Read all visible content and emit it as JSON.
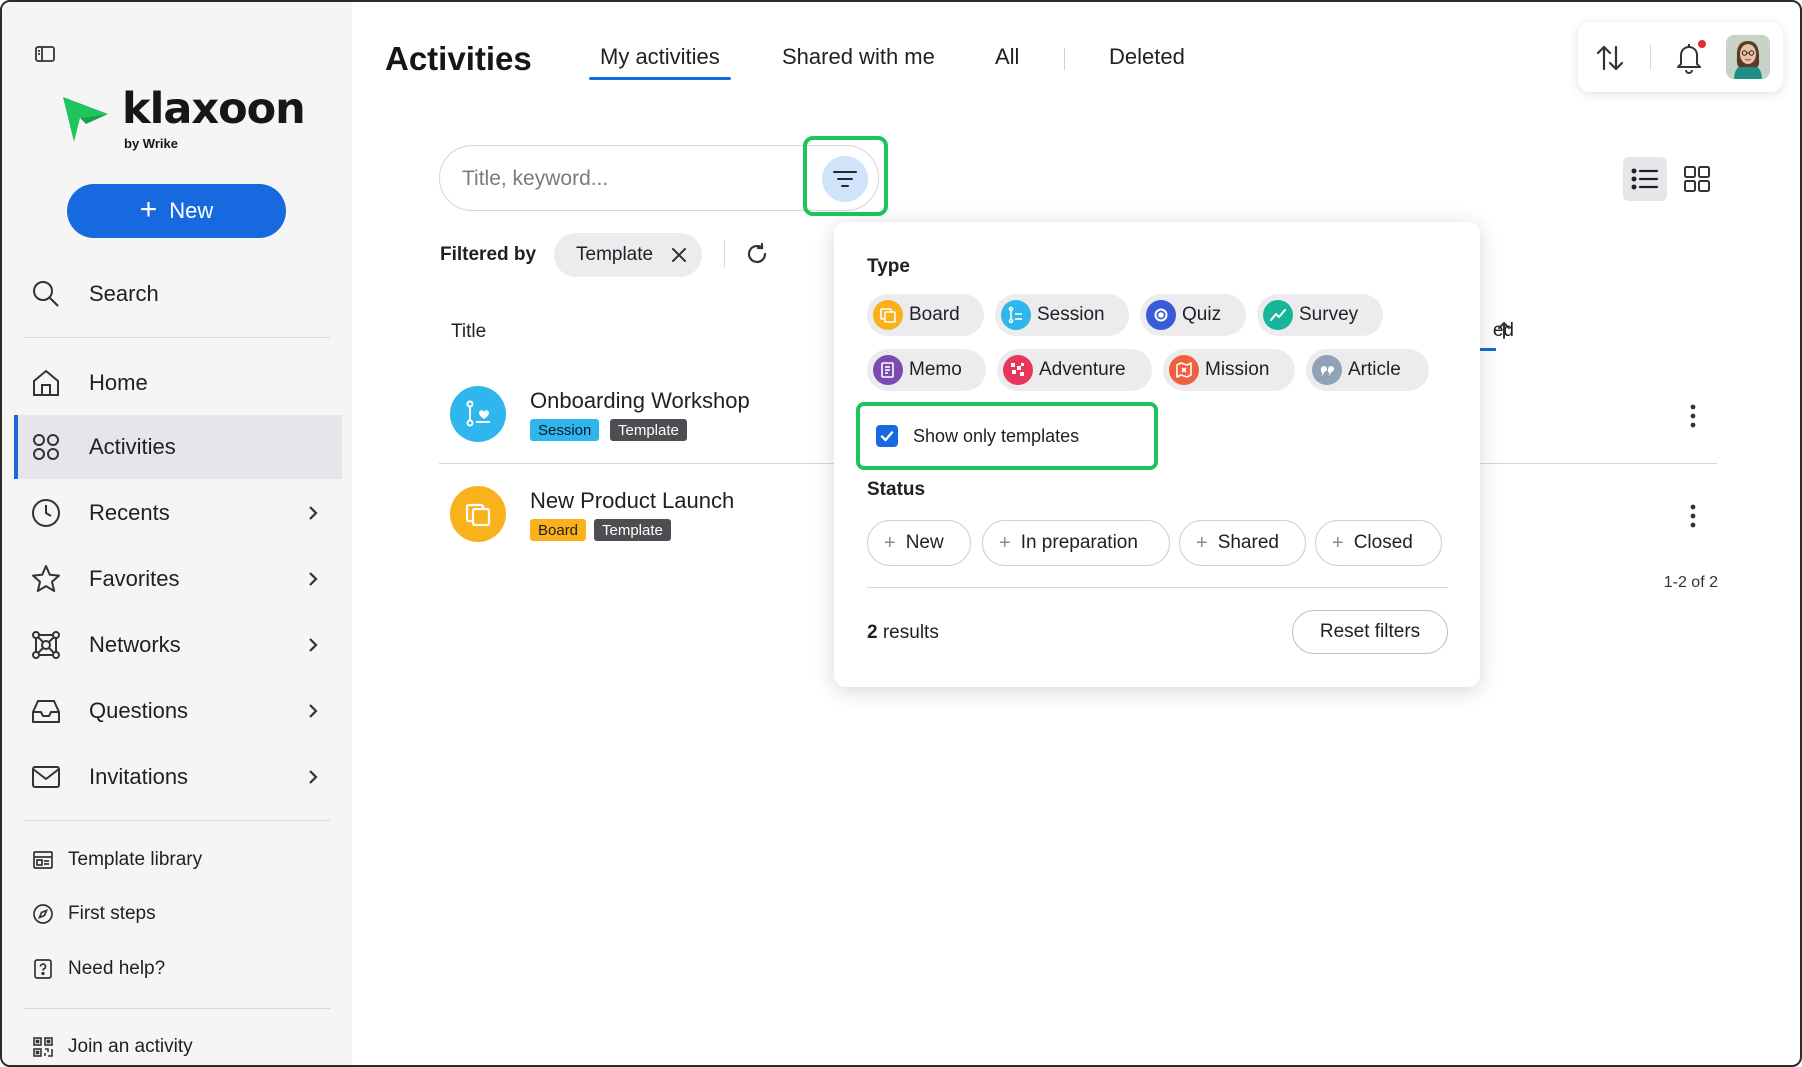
{
  "brand": {
    "name": "klaxoon",
    "sub": "by Wrike",
    "color": "#1fc45b"
  },
  "sidebar": {
    "new_label": "New",
    "search_label": "Search",
    "items": [
      {
        "label": "Home",
        "icon": "home-icon"
      },
      {
        "label": "Activities",
        "icon": "activities-icon",
        "active": true
      },
      {
        "label": "Recents",
        "icon": "clock-icon"
      },
      {
        "label": "Favorites",
        "icon": "star-icon"
      },
      {
        "label": "Networks",
        "icon": "network-icon"
      },
      {
        "label": "Questions",
        "icon": "inbox-icon"
      },
      {
        "label": "Invitations",
        "icon": "envelope-icon"
      }
    ],
    "bottom": [
      {
        "label": "Template library",
        "icon": "template-library-icon"
      },
      {
        "label": "First steps",
        "icon": "compass-icon"
      },
      {
        "label": "Need help?",
        "icon": "help-icon"
      },
      {
        "label": "Join an activity",
        "icon": "qr-code-icon"
      }
    ]
  },
  "header": {
    "title": "Activities",
    "tabs": [
      {
        "label": "My activities",
        "active": true
      },
      {
        "label": "Shared with me"
      },
      {
        "label": "All"
      },
      {
        "label": "Deleted"
      }
    ]
  },
  "search": {
    "placeholder": "Title, keyword..."
  },
  "filters": {
    "filtered_by_label": "Filtered by",
    "active_chips": [
      {
        "label": "Template"
      }
    ]
  },
  "table": {
    "col_title": "Title",
    "col_modified_fragment": "ed",
    "rows": [
      {
        "name": "Onboarding Workshop",
        "type": "Session",
        "tag": "Template",
        "color": "#2fb6ec"
      },
      {
        "name": "New Product Launch",
        "type": "Board",
        "tag": "Template",
        "color": "#f9b21c"
      }
    ],
    "pagination": "1-2 of 2"
  },
  "popover": {
    "type_heading": "Type",
    "types": [
      {
        "label": "Board",
        "icon": "board-icon",
        "color": "#f9b21c"
      },
      {
        "label": "Session",
        "icon": "session-icon",
        "color": "#2fb6ec"
      },
      {
        "label": "Quiz",
        "icon": "quiz-icon",
        "color": "#3a5bd9"
      },
      {
        "label": "Survey",
        "icon": "survey-icon",
        "color": "#17b59a"
      },
      {
        "label": "Memo",
        "icon": "memo-icon",
        "color": "#7a4bb0"
      },
      {
        "label": "Adventure",
        "icon": "adventure-icon",
        "color": "#e8365d"
      },
      {
        "label": "Mission",
        "icon": "mission-icon",
        "color": "#f0603e"
      },
      {
        "label": "Article",
        "icon": "article-icon",
        "color": "#8fa2b8"
      }
    ],
    "show_only_templates": {
      "label": "Show only templates",
      "checked": true
    },
    "status_heading": "Status",
    "statuses": [
      {
        "label": "New"
      },
      {
        "label": "In preparation"
      },
      {
        "label": "Shared"
      },
      {
        "label": "Closed"
      }
    ],
    "results_count": "2",
    "results_label": "results",
    "reset_label": "Reset filters"
  },
  "colors": {
    "accent": "#1769e0",
    "highlight": "#1fc45b"
  }
}
